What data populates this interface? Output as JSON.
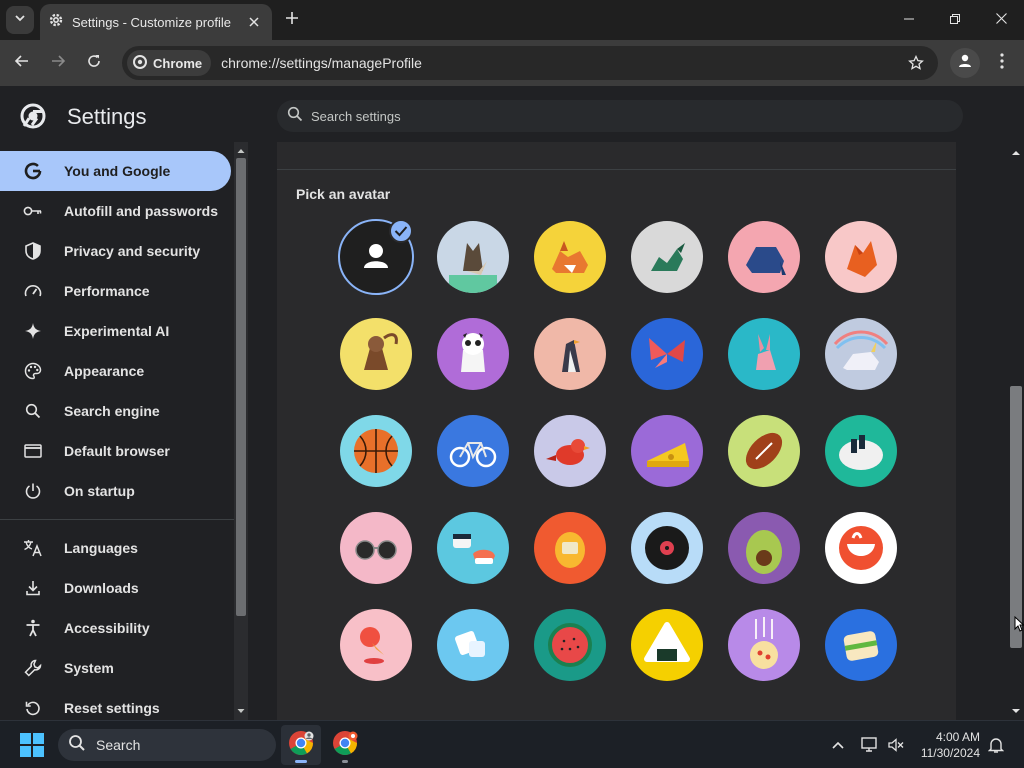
{
  "browser": {
    "tab_title": "Settings - Customize profile",
    "chip_label": "Chrome",
    "url": "chrome://settings/manageProfile"
  },
  "settings": {
    "title": "Settings",
    "search_placeholder": "Search settings"
  },
  "sidebar": {
    "items": [
      {
        "label": "You and Google",
        "icon": "google-g-icon",
        "active": true
      },
      {
        "label": "Autofill and passwords",
        "icon": "key-icon"
      },
      {
        "label": "Privacy and security",
        "icon": "shield-icon"
      },
      {
        "label": "Performance",
        "icon": "speedometer-icon"
      },
      {
        "label": "Experimental AI",
        "icon": "sparkle-icon"
      },
      {
        "label": "Appearance",
        "icon": "palette-icon"
      },
      {
        "label": "Search engine",
        "icon": "search-icon"
      },
      {
        "label": "Default browser",
        "icon": "browser-window-icon"
      },
      {
        "label": "On startup",
        "icon": "power-icon"
      },
      {
        "label": "Languages",
        "icon": "translate-icon"
      },
      {
        "label": "Downloads",
        "icon": "download-icon"
      },
      {
        "label": "Accessibility",
        "icon": "accessibility-icon"
      },
      {
        "label": "System",
        "icon": "wrench-icon"
      },
      {
        "label": "Reset settings",
        "icon": "reset-icon"
      }
    ]
  },
  "main": {
    "section_label": "Pick an avatar",
    "avatars": [
      {
        "name": "generic-person",
        "bg": "#1f1f1f",
        "selected": true
      },
      {
        "name": "origami-cat",
        "bg": "#c9d7e6"
      },
      {
        "name": "origami-corgi",
        "bg": "#f5d33a"
      },
      {
        "name": "origami-dragon",
        "bg": "#d9d9d9"
      },
      {
        "name": "origami-elephant",
        "bg": "#f4a6b0"
      },
      {
        "name": "origami-fox",
        "bg": "#f8c8c8"
      },
      {
        "name": "origami-monkey",
        "bg": "#f3e06a"
      },
      {
        "name": "origami-panda",
        "bg": "#b06cd8"
      },
      {
        "name": "origami-penguin",
        "bg": "#f0b8a8"
      },
      {
        "name": "origami-butterfly",
        "bg": "#2a66d9"
      },
      {
        "name": "origami-rabbit",
        "bg": "#2ab8c8"
      },
      {
        "name": "origami-unicorn",
        "bg": "#c0cbe0"
      },
      {
        "name": "basketball",
        "bg": "#7fd8e8"
      },
      {
        "name": "bicycle",
        "bg": "#3a78e0"
      },
      {
        "name": "bird",
        "bg": "#c9c9e8"
      },
      {
        "name": "cheese",
        "bg": "#9b6ad8"
      },
      {
        "name": "football",
        "bg": "#c8e07a"
      },
      {
        "name": "sushi-plate",
        "bg": "#1fb89a"
      },
      {
        "name": "sunglasses",
        "bg": "#f4b8c8"
      },
      {
        "name": "sushi",
        "bg": "#5cc8e0"
      },
      {
        "name": "tamagotchi",
        "bg": "#f05a30"
      },
      {
        "name": "vinyl-record",
        "bg": "#b8dcf8"
      },
      {
        "name": "avocado",
        "bg": "#8a5ab0"
      },
      {
        "name": "smiley",
        "bg": "#ffffff"
      },
      {
        "name": "ice-cream",
        "bg": "#f8c0c8"
      },
      {
        "name": "note",
        "bg": "#6cc8f0"
      },
      {
        "name": "watermelon",
        "bg": "#1a9a88"
      },
      {
        "name": "onigiri",
        "bg": "#f5d000"
      },
      {
        "name": "pizza",
        "bg": "#b88ae8"
      },
      {
        "name": "sandwich",
        "bg": "#2a70e0"
      }
    ]
  },
  "taskbar": {
    "search_label": "Search",
    "time": "4:00 AM",
    "date": "11/30/2024"
  },
  "colors": {
    "accent": "#a8c7fa",
    "check": "#8ab4f8"
  }
}
